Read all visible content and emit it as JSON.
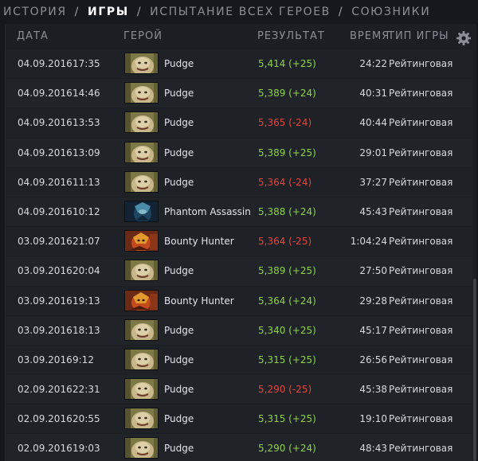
{
  "breadcrumb": {
    "items": [
      {
        "label": "ИСТОРИЯ",
        "active": false
      },
      {
        "label": "ИГРЫ",
        "active": true
      },
      {
        "label": "ИСПЫТАНИЕ ВСЕХ ГЕРОЕВ",
        "active": false
      },
      {
        "label": "СОЮЗНИКИ",
        "active": false
      }
    ],
    "separator": "/"
  },
  "table": {
    "headers": {
      "date": "ДАТА",
      "hero": "ГЕРОЙ",
      "result": "РЕЗУЛЬТАТ",
      "time": "ВРЕМЯ",
      "type": "ТИП ИГРЫ"
    },
    "settings_icon": "gear-icon",
    "rows": [
      {
        "date": "04.09.2016",
        "time": "17:35",
        "hero": "Pudge",
        "portrait": "pudge",
        "result": "5,414 (+25)",
        "outcome": "win",
        "duration": "24:22",
        "type": "Рейтинговая"
      },
      {
        "date": "04.09.2016",
        "time": "14:46",
        "hero": "Pudge",
        "portrait": "pudge",
        "result": "5,389 (+24)",
        "outcome": "win",
        "duration": "40:31",
        "type": "Рейтинговая"
      },
      {
        "date": "04.09.2016",
        "time": "13:53",
        "hero": "Pudge",
        "portrait": "pudge",
        "result": "5,365 (-24)",
        "outcome": "loss",
        "duration": "40:44",
        "type": "Рейтинговая"
      },
      {
        "date": "04.09.2016",
        "time": "13:09",
        "hero": "Pudge",
        "portrait": "pudge",
        "result": "5,389 (+25)",
        "outcome": "win",
        "duration": "29:01",
        "type": "Рейтинговая"
      },
      {
        "date": "04.09.2016",
        "time": "11:13",
        "hero": "Pudge",
        "portrait": "pudge",
        "result": "5,364 (-24)",
        "outcome": "loss",
        "duration": "37:27",
        "type": "Рейтинговая"
      },
      {
        "date": "04.09.2016",
        "time": "10:12",
        "hero": "Phantom Assassin",
        "portrait": "phantom-assassin",
        "result": "5,388 (+24)",
        "outcome": "win",
        "duration": "45:43",
        "type": "Рейтинговая"
      },
      {
        "date": "03.09.2016",
        "time": "21:07",
        "hero": "Bounty Hunter",
        "portrait": "bounty-hunter",
        "result": "5,364 (-25)",
        "outcome": "loss",
        "duration": "1:04:24",
        "type": "Рейтинговая"
      },
      {
        "date": "03.09.2016",
        "time": "20:04",
        "hero": "Pudge",
        "portrait": "pudge",
        "result": "5,389 (+25)",
        "outcome": "win",
        "duration": "27:50",
        "type": "Рейтинговая"
      },
      {
        "date": "03.09.2016",
        "time": "19:13",
        "hero": "Bounty Hunter",
        "portrait": "bounty-hunter",
        "result": "5,364 (+24)",
        "outcome": "win",
        "duration": "29:28",
        "type": "Рейтинговая"
      },
      {
        "date": "03.09.2016",
        "time": "18:13",
        "hero": "Pudge",
        "portrait": "pudge",
        "result": "5,340 (+25)",
        "outcome": "win",
        "duration": "45:17",
        "type": "Рейтинговая"
      },
      {
        "date": "03.09.2016",
        "time": "9:12",
        "hero": "Pudge",
        "portrait": "pudge",
        "result": "5,315 (+25)",
        "outcome": "win",
        "duration": "26:56",
        "type": "Рейтинговая"
      },
      {
        "date": "02.09.2016",
        "time": "22:31",
        "hero": "Pudge",
        "portrait": "pudge",
        "result": "5,290 (-25)",
        "outcome": "loss",
        "duration": "45:38",
        "type": "Рейтинговая"
      },
      {
        "date": "02.09.2016",
        "time": "20:55",
        "hero": "Pudge",
        "portrait": "pudge",
        "result": "5,315 (+25)",
        "outcome": "win",
        "duration": "19:10",
        "type": "Рейтинговая"
      },
      {
        "date": "02.09.2016",
        "time": "19:03",
        "hero": "Pudge",
        "portrait": "pudge",
        "result": "5,290 (+24)",
        "outcome": "win",
        "duration": "48:43",
        "type": "Рейтинговая"
      }
    ]
  },
  "colors": {
    "win": "#8fd14f",
    "loss": "#e5463e",
    "header_text": "#8a8f96",
    "active_tab": "#ffffff"
  }
}
